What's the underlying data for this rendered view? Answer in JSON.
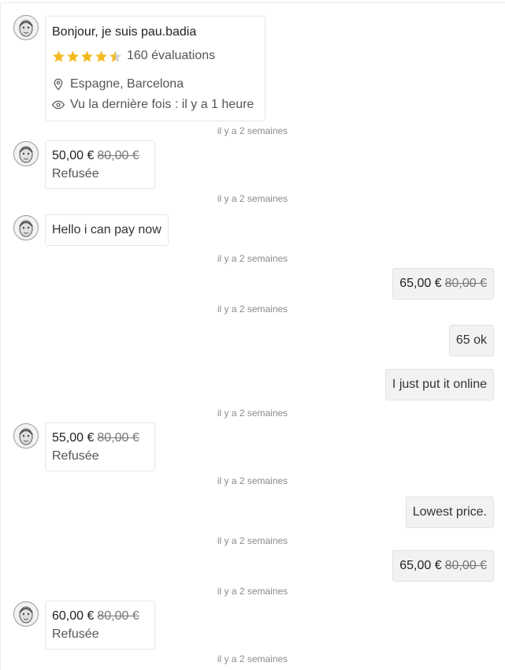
{
  "profile": {
    "greeting": "Bonjour, je suis pau.badia",
    "rating_value": 4.5,
    "rating_max": 5,
    "reviews": "160 évaluations",
    "location": "Espagne, Barcelona",
    "last_seen": "Vu la dernière fois : il y a 1 heure",
    "star_color": "#f5b921"
  },
  "timestamps": [
    "il y a 2 semaines",
    "il y a 2 semaines",
    "il y a 2 semaines",
    "il y a 2 semaines",
    "il y a 2 semaines",
    "il y a 2 semaines",
    "il y a 2 semaines",
    "il y a 2 semaines",
    "il y a 2 semaines"
  ],
  "messages": {
    "offer1": {
      "price": "50,00 €",
      "old": "80,00 €",
      "status": "Refusée"
    },
    "text1": "Hello i can pay now",
    "offer2": {
      "price": "65,00 €",
      "old": "80,00 €"
    },
    "text2": "65 ok",
    "text3": "I just put it online",
    "offer3": {
      "price": "55,00 €",
      "old": "80,00 €",
      "status": "Refusée"
    },
    "text4": "Lowest price.",
    "offer4": {
      "price": "65,00 €",
      "old": "80,00 €"
    },
    "offer5": {
      "price": "60,00 €",
      "old": "80,00 €",
      "status": "Refusée"
    }
  }
}
